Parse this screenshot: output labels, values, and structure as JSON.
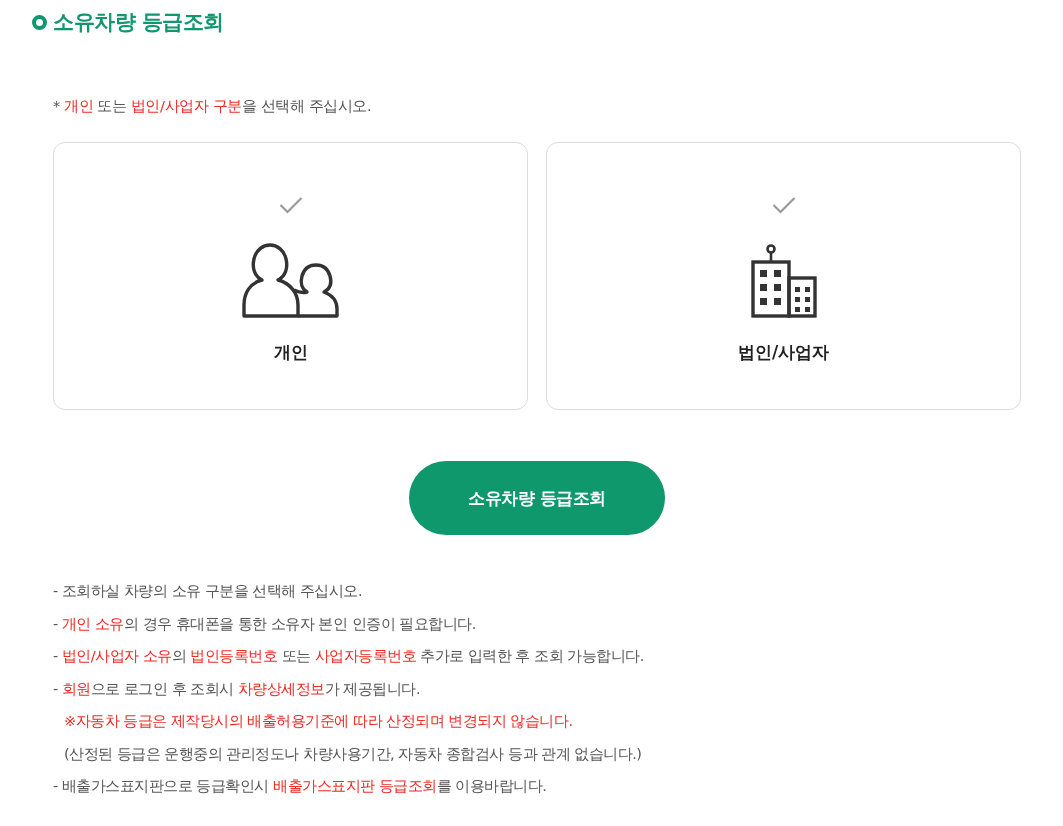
{
  "title": {
    "text": "소유차량 등급조회"
  },
  "instruction": [
    {
      "text": "* ",
      "highlight": false
    },
    {
      "text": "개인",
      "highlight": true
    },
    {
      "text": " 또는 ",
      "highlight": false
    },
    {
      "text": "법인/사업자 구분",
      "highlight": true
    },
    {
      "text": "을 선택해 주십시오.",
      "highlight": false
    }
  ],
  "cards": [
    {
      "kind": "person",
      "label": "개인",
      "selected": false
    },
    {
      "kind": "building",
      "label": "법인/사업자",
      "selected": false
    }
  ],
  "submit_button": {
    "label": "소유차량 등급조회"
  },
  "notes": [
    {
      "kind": "item",
      "segments": [
        {
          "text": "- 조회하실 차량의 소유 구분을 선택해 주십시오.",
          "highlight": false
        }
      ]
    },
    {
      "kind": "item",
      "segments": [
        {
          "text": "- ",
          "highlight": false
        },
        {
          "text": "개인 소유",
          "highlight": true
        },
        {
          "text": "의 경우 휴대폰을 통한 소유자 본인 인증이 필요합니다.",
          "highlight": false
        }
      ]
    },
    {
      "kind": "item",
      "segments": [
        {
          "text": "- ",
          "highlight": false
        },
        {
          "text": "법인/사업자 소유",
          "highlight": true
        },
        {
          "text": "의 ",
          "highlight": false
        },
        {
          "text": "법인등록번호",
          "highlight": true
        },
        {
          "text": " 또는 ",
          "highlight": false
        },
        {
          "text": "사업자등록번호",
          "highlight": true
        },
        {
          "text": " 추가로 입력한 후 조회 가능합니다.",
          "highlight": false
        }
      ]
    },
    {
      "kind": "item",
      "segments": [
        {
          "text": "- ",
          "highlight": false
        },
        {
          "text": "회원",
          "highlight": true
        },
        {
          "text": "으로 로그인 후 조회시 ",
          "highlight": false
        },
        {
          "text": "차량상세정보",
          "highlight": true
        },
        {
          "text": "가 제공됩니다.",
          "highlight": false
        }
      ]
    },
    {
      "kind": "sub",
      "segments": [
        {
          "text": "※자동차 등급은 제작당시의 배출허용기준에 따라 산정되며 변경되지 않습니다.",
          "highlight": true
        }
      ]
    },
    {
      "kind": "sub",
      "segments": [
        {
          "text": "(산정된 등급은 운행중의 관리정도나 차량사용기간, 자동차 종합검사 등과 관계 없습니다.)",
          "highlight": false
        }
      ]
    },
    {
      "kind": "item",
      "segments": [
        {
          "text": "- 배출가스표지판으로 등급확인시 ",
          "highlight": false
        },
        {
          "text": "배출가스표지판 등급조회",
          "highlight": true
        },
        {
          "text": "를 이용바랍니다.",
          "highlight": false
        }
      ]
    }
  ]
}
